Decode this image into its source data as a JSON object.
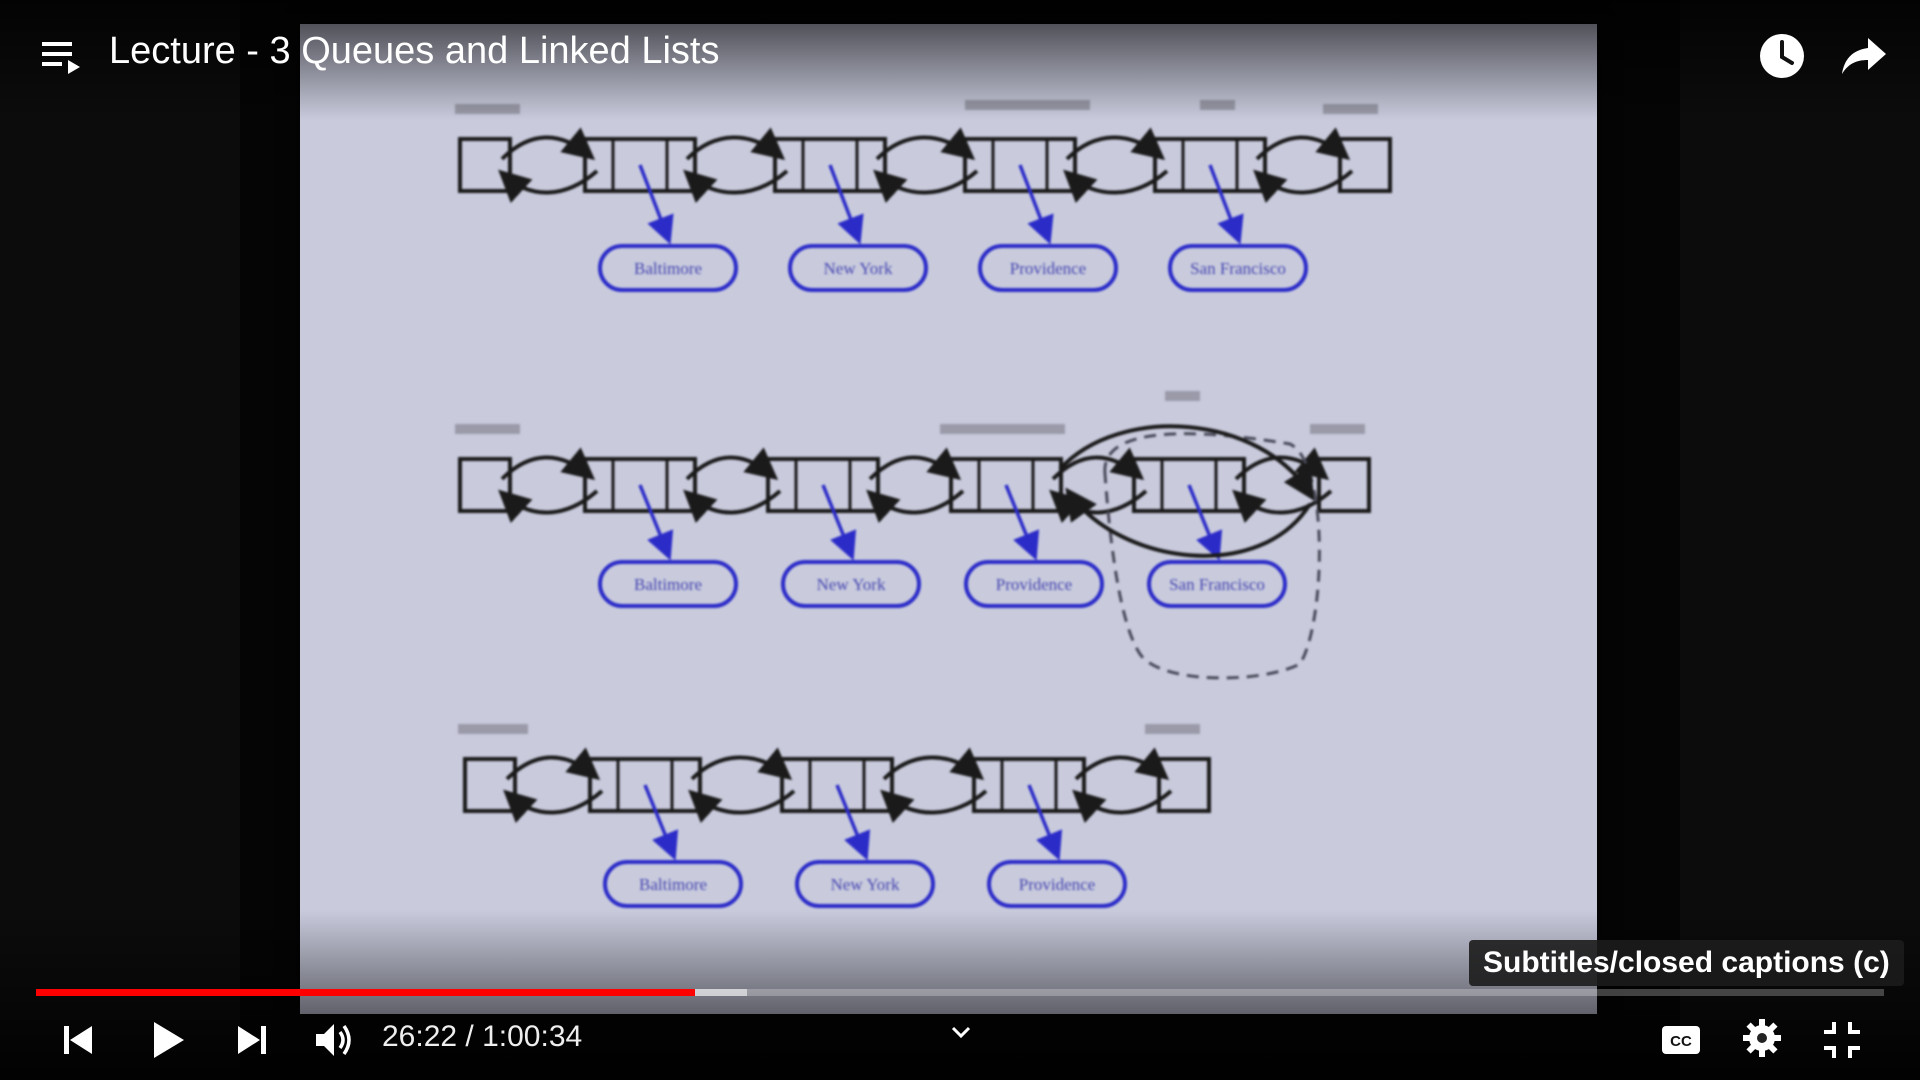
{
  "video": {
    "title": "Lecture - 3 Queues and Linked Lists",
    "current_time": "26:22",
    "separator": " / ",
    "duration": "1:00:34",
    "played_fraction": 0.3567,
    "buffered_fraction": 0.3845
  },
  "tooltip": {
    "text": "Subtitles/closed captions (c)"
  },
  "slide": {
    "list1": {
      "nodes": [
        "Baltimore",
        "New York",
        "Providence",
        "San Francisco"
      ]
    },
    "list2": {
      "nodes": [
        "Baltimore",
        "New York",
        "Providence",
        "San Francisco"
      ]
    },
    "list3": {
      "nodes": [
        "Baltimore",
        "New York",
        "Providence"
      ]
    }
  },
  "colors": {
    "progress_played": "#ff0000",
    "slide_background": "#c9cbdd",
    "node_blue": "#2b2bc8"
  },
  "icons": {
    "playlist": "playlist-icon",
    "watch_later": "clock-icon",
    "share": "share-icon",
    "previous": "skip-previous-icon",
    "play": "play-icon",
    "next": "skip-next-icon",
    "volume": "volume-icon",
    "chapter": "chevron-down-icon",
    "captions": "cc-icon",
    "settings": "gear-icon",
    "exit_fullscreen": "exit-fullscreen-icon"
  }
}
